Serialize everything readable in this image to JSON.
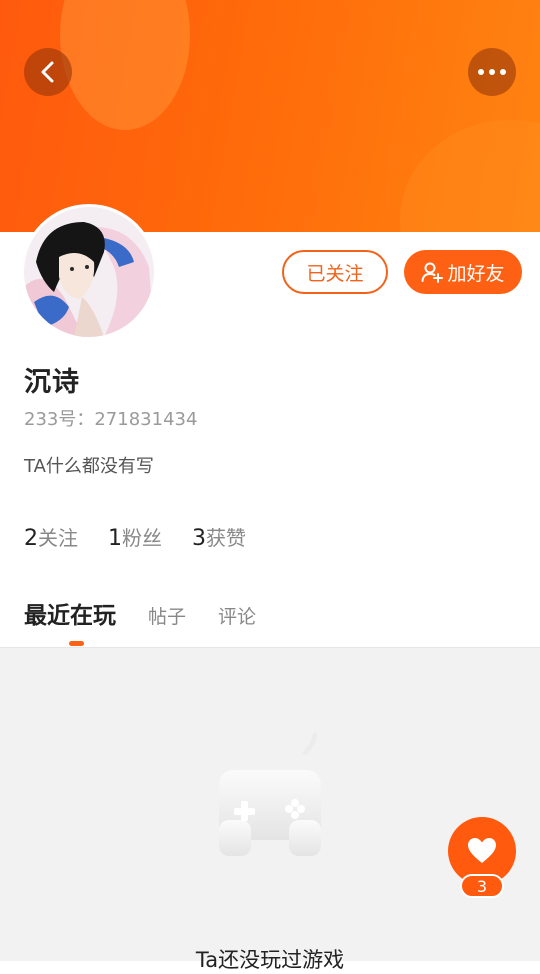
{
  "header": {
    "back_icon": "chevron-left-icon",
    "more_icon": "more-dots-icon",
    "accent_color": "#ff6114"
  },
  "profile": {
    "follow_label": "已关注",
    "add_friend_label": "加好友",
    "add_friend_icon": "add-user-icon",
    "username": "沉诗",
    "id_text": "233号：271831434",
    "bio": "TA什么都没有写"
  },
  "stats": [
    {
      "num": "2",
      "label": "关注"
    },
    {
      "num": "1",
      "label": "粉丝"
    },
    {
      "num": "3",
      "label": "获赞"
    }
  ],
  "tabs": [
    {
      "label": "最近在玩",
      "active": true
    },
    {
      "label": "帖子",
      "active": false
    },
    {
      "label": "评论",
      "active": false
    }
  ],
  "empty_state": {
    "icon": "gamepad-icon",
    "text": "Ta还没玩过游戏"
  },
  "like": {
    "icon": "heart-icon",
    "count": "3"
  }
}
